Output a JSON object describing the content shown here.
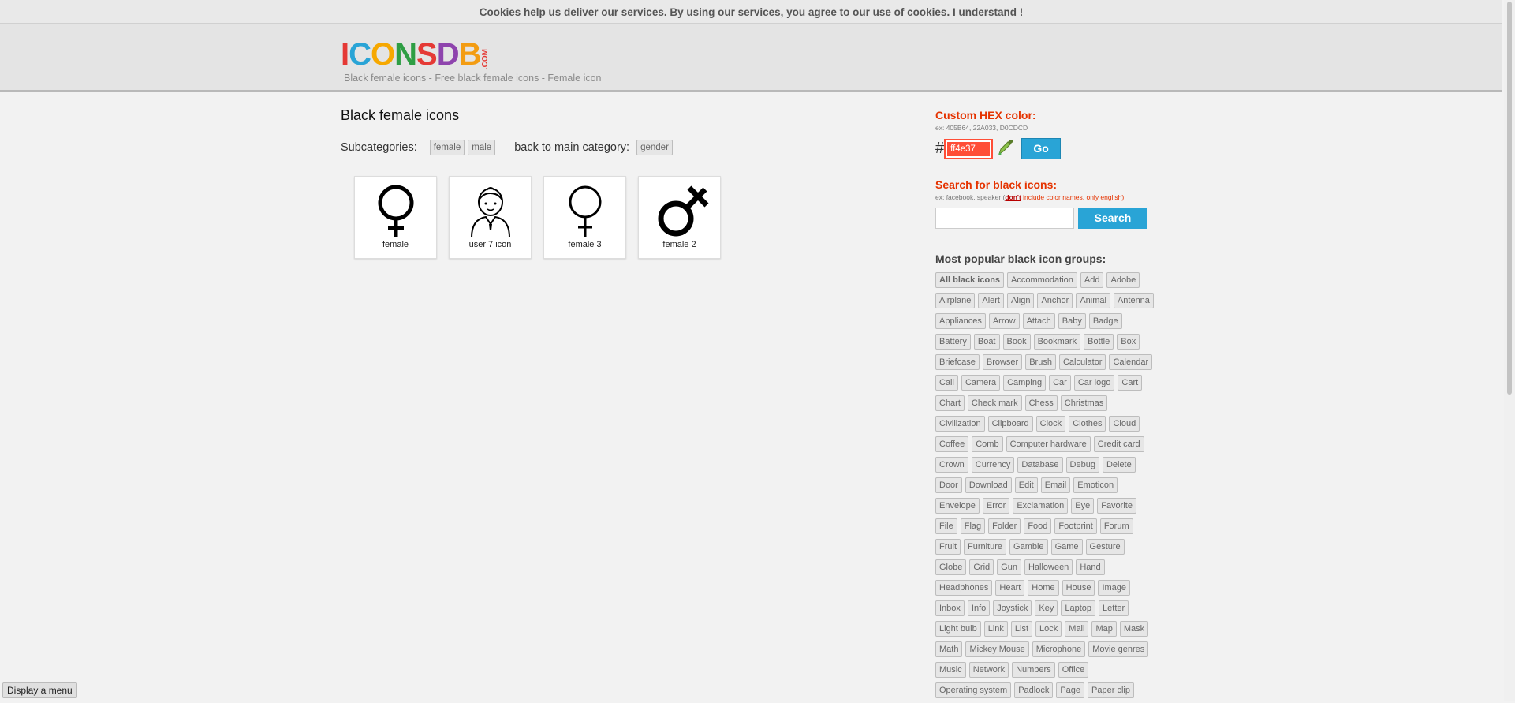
{
  "cookie": {
    "text": "Cookies help us deliver our services. By using our services, you agree to our use of cookies.",
    "link": "I understand",
    "suffix": "!"
  },
  "header": {
    "logo_letters": [
      "I",
      "C",
      "O",
      "N",
      "S",
      "D",
      "B"
    ],
    "logo_colors": [
      "#e53935",
      "#29a4d6",
      "#f6a800",
      "#2e9e44",
      "#e53935",
      "#8e44ad",
      "#f39c12"
    ],
    "logo_suffix": ".COM",
    "subtitle": "Black female icons - Free black female icons - Female icon"
  },
  "main": {
    "title": "Black female icons",
    "subcategories_label": "Subcategories:",
    "subcategories": [
      "female",
      "male"
    ],
    "back_label": "back to main category:",
    "back_tag": "gender",
    "icons": [
      {
        "name": "female",
        "icon": "female-symbol-icon"
      },
      {
        "name": "user 7 icon",
        "icon": "user-woman-icon"
      },
      {
        "name": "female 3",
        "icon": "female-symbol-thin-icon"
      },
      {
        "name": "female 2",
        "icon": "female-cross-icon"
      }
    ]
  },
  "side": {
    "hex_title": "Custom HEX color:",
    "hex_example": "ex: 405B64, 22A033, D0CDCD",
    "hash": "#",
    "hex_value": "ff4e37",
    "go_label": "Go",
    "search_title": "Search for black icons:",
    "search_example_prefix": "ex: facebook, speaker (",
    "search_example_dont": "don't",
    "search_example_suffix": " include color names, only english)",
    "search_label": "Search",
    "groups_title": "Most popular black icon groups:",
    "groups": [
      [
        "All black icons",
        "Accommodation",
        "Add",
        "Adobe"
      ],
      [
        "Airplane",
        "Alert",
        "Align",
        "Anchor",
        "Animal",
        "Antenna"
      ],
      [
        "Appliances",
        "Arrow",
        "Attach",
        "Baby",
        "Badge"
      ],
      [
        "Battery",
        "Boat",
        "Book",
        "Bookmark",
        "Bottle",
        "Box"
      ],
      [
        "Briefcase",
        "Browser",
        "Brush",
        "Calculator",
        "Calendar"
      ],
      [
        "Call",
        "Camera",
        "Camping",
        "Car",
        "Car logo",
        "Cart"
      ],
      [
        "Chart",
        "Check mark",
        "Chess",
        "Christmas"
      ],
      [
        "Civilization",
        "Clipboard",
        "Clock",
        "Clothes",
        "Cloud"
      ],
      [
        "Coffee",
        "Comb",
        "Computer hardware",
        "Credit card"
      ],
      [
        "Crown",
        "Currency",
        "Database",
        "Debug",
        "Delete"
      ],
      [
        "Door",
        "Download",
        "Edit",
        "Email",
        "Emoticon"
      ],
      [
        "Envelope",
        "Error",
        "Exclamation",
        "Eye",
        "Favorite"
      ],
      [
        "File",
        "Flag",
        "Folder",
        "Food",
        "Footprint",
        "Forum"
      ],
      [
        "Fruit",
        "Furniture",
        "Gamble",
        "Game",
        "Gesture"
      ],
      [
        "Globe",
        "Grid",
        "Gun",
        "Halloween",
        "Hand"
      ],
      [
        "Headphones",
        "Heart",
        "Home",
        "House",
        "Image"
      ],
      [
        "Inbox",
        "Info",
        "Joystick",
        "Key",
        "Laptop",
        "Letter"
      ],
      [
        "Light bulb",
        "Link",
        "List",
        "Lock",
        "Mail",
        "Map",
        "Mask"
      ],
      [
        "Math",
        "Mickey Mouse",
        "Microphone",
        "Movie genres"
      ],
      [
        "Music",
        "Network",
        "Numbers",
        "Office"
      ],
      [
        "Operating system",
        "Padlock",
        "Page",
        "Paper clip"
      ]
    ]
  },
  "footer": {
    "display_menu": "Display a menu"
  }
}
